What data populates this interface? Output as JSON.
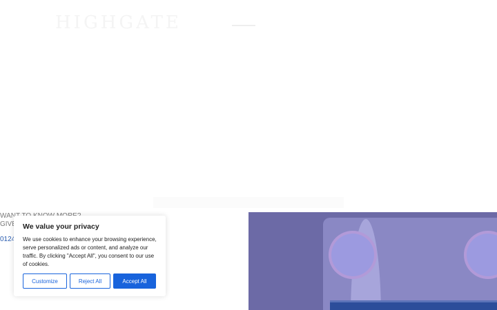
{
  "header": {
    "logo_text": "HIGHGATE"
  },
  "cta": {
    "line1": "WANT TO KNOW MORE?",
    "line2": "GIVE",
    "phone": "01245"
  },
  "cookie_banner": {
    "title": "We value your privacy",
    "body": "We use cookies to enhance your browsing experience, serve personalized ads or content, and analyze our traffic. By clicking \"Accept All\", you consent to our use of cookies.",
    "buttons": {
      "customize": "Customize",
      "reject": "Reject All",
      "accept": "Accept All"
    }
  },
  "colors": {
    "primary_button": "#1863dc",
    "hero_tint": "#6c6aa6"
  }
}
